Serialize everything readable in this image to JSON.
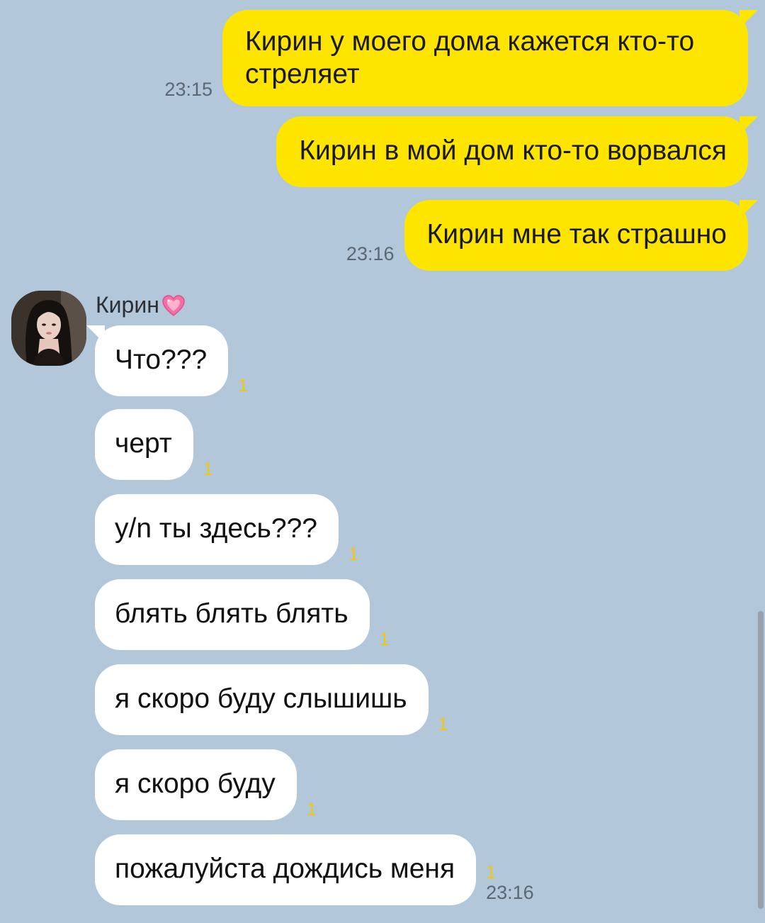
{
  "colors": {
    "background": "#b2c7d9",
    "outgoing_bubble": "#fee500",
    "incoming_bubble": "#ffffff",
    "unread_count": "#f2c80f",
    "timestamp": "#5b6873"
  },
  "outgoing": [
    {
      "text": "Кирин у моего дома кажется кто-то стреляет",
      "time": "23:15"
    },
    {
      "text": "Кирин в мой дом кто-то ворвался",
      "time": ""
    },
    {
      "text": "Кирин мне так страшно",
      "time": "23:16"
    }
  ],
  "contact": {
    "name": "Кирин",
    "avatar_icon": "profile-photo",
    "name_emoji_icon": "sparkling-heart-icon"
  },
  "incoming": [
    {
      "text": "Что???",
      "unread": "1",
      "time": ""
    },
    {
      "text": "черт",
      "unread": "1",
      "time": ""
    },
    {
      "text": "y/n ты здесь???",
      "unread": "1",
      "time": ""
    },
    {
      "text": "блять блять блять",
      "unread": "1",
      "time": ""
    },
    {
      "text": "я скоро буду слышишь",
      "unread": "1",
      "time": ""
    },
    {
      "text": "я скоро буду",
      "unread": "1",
      "time": ""
    },
    {
      "text": "пожалуйста дождись меня",
      "unread": "1",
      "time": "23:16"
    }
  ]
}
